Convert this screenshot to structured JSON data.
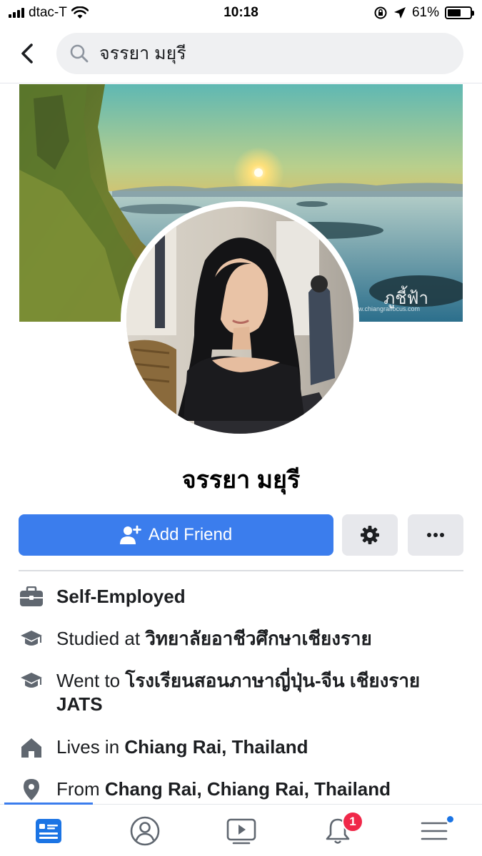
{
  "status_bar": {
    "carrier": "dtac-T",
    "time": "10:18",
    "battery_percent": "61%",
    "battery_level": 0.61
  },
  "search": {
    "query": "จรรยา มยุรี"
  },
  "cover": {
    "watermark": "ภูชี้ฟ้า",
    "watermark_url": "www.chiangraifocus.com"
  },
  "profile": {
    "name": "จรรยา มยุรี"
  },
  "actions": {
    "add_friend_label": "Add Friend"
  },
  "info": {
    "work": "Self-Employed",
    "studied_prefix": "Studied at ",
    "studied_place": "วิทยาลัยอาชีวศึกษาเชียงราย",
    "went_prefix": "Went to ",
    "went_place": "โรงเรียนสอนภาษาญี่ปุ่น-จีน เชียงราย JATS",
    "lives_prefix": "Lives in ",
    "lives_place": "Chiang Rai, Thailand",
    "from_prefix": "From ",
    "from_place": "Chang Rai, Chiang Rai, Thailand"
  },
  "bottom_nav": {
    "notification_count": "1"
  },
  "colors": {
    "accent": "#3b7ded",
    "badge": "#f02849",
    "icon_gray": "#606770"
  }
}
